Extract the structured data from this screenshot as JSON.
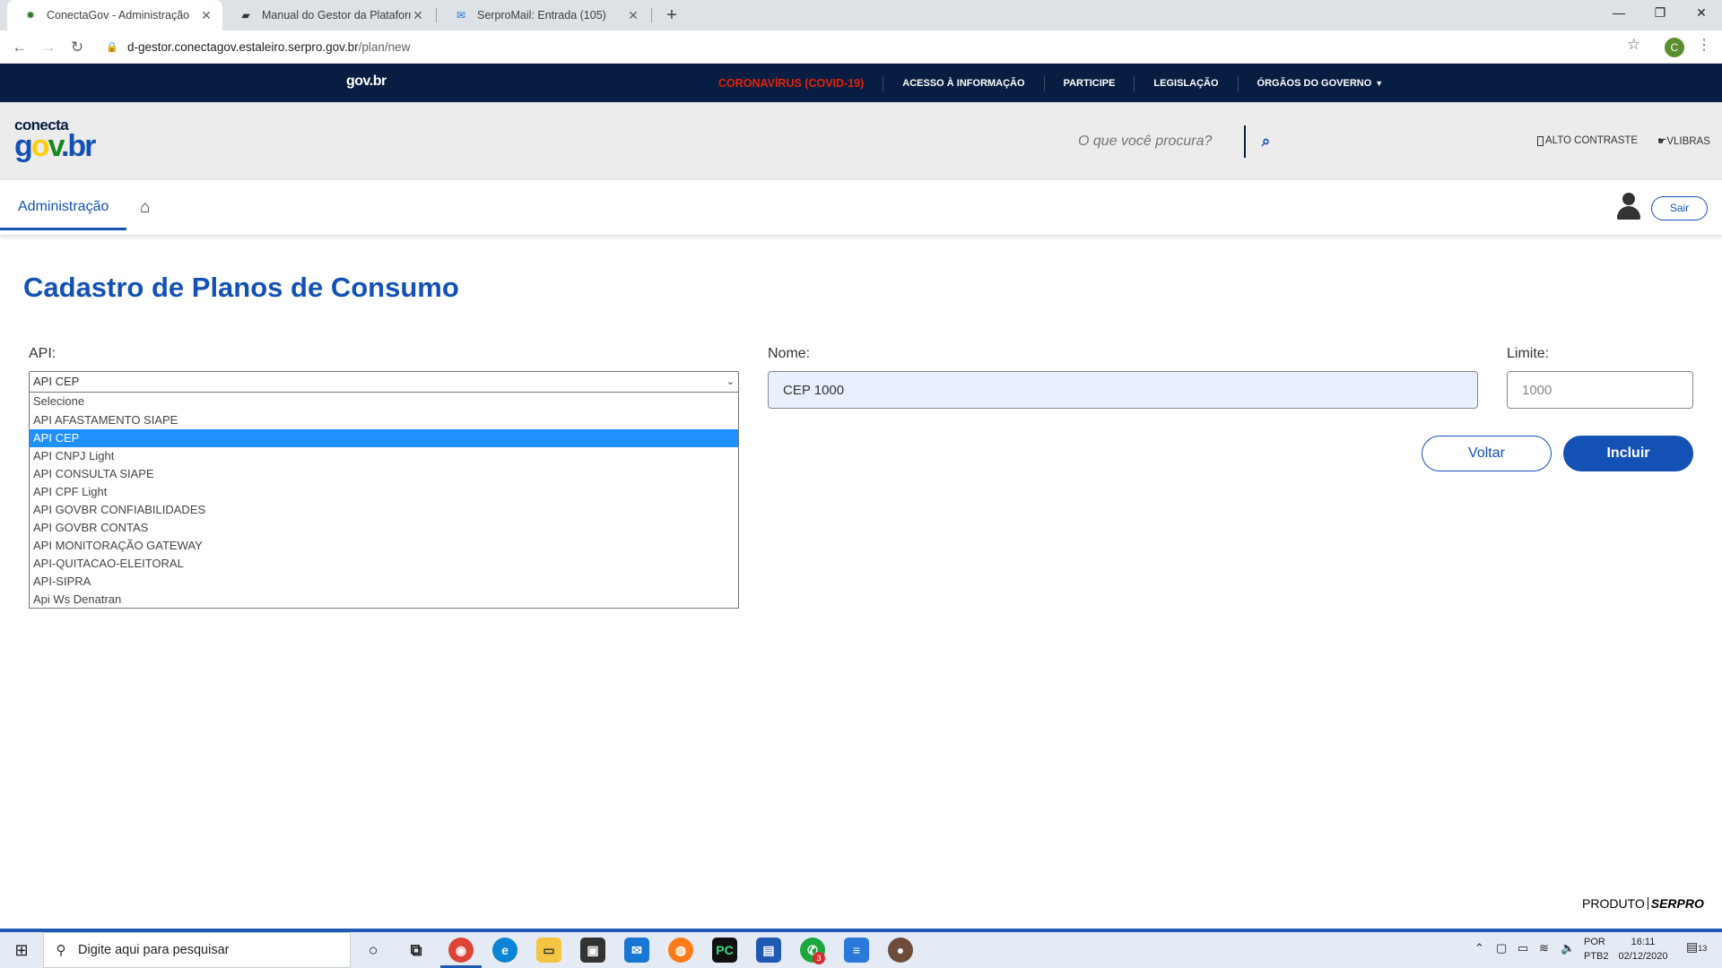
{
  "browser": {
    "tabs": [
      {
        "title": "ConectaGov - Administração",
        "favicon": "gov-gear-icon",
        "active": true
      },
      {
        "title": "Manual do Gestor da Plataforma",
        "favicon": "book-icon",
        "active": false
      },
      {
        "title": "SerproMail: Entrada (105)",
        "favicon": "mail-icon",
        "active": false
      }
    ],
    "url_host": "d-gestor.conectagov.estaleiro.serpro.gov.br",
    "url_path": "/plan/new",
    "profile_initial": "C"
  },
  "govbar": {
    "brand": "gov.br",
    "links": {
      "covid": "CORONAVÍRUS (COVID-19)",
      "acesso": "ACESSO À INFORMAÇÃO",
      "participe": "PARTICIPE",
      "legislacao": "LEGISLAÇÃO",
      "orgaos": "ÓRGÃOS DO GOVERNO"
    },
    "covid_color": "#e52207"
  },
  "header": {
    "logo_top": "conecta",
    "logo_g": "g",
    "logo_o": "o",
    "logo_v": "v",
    "logo_br": ".br",
    "search_placeholder": "O que você procura?",
    "contrast_label": "ALTO CONTRASTE",
    "vlibras_label": "VLIBRAS"
  },
  "appnav": {
    "admin_label": "Administração",
    "logout_label": "Sair"
  },
  "page": {
    "title": "Cadastro de Planos de Consumo",
    "accent_color": "#1351b4"
  },
  "form": {
    "api_label": "API:",
    "api_value": "API CEP",
    "api_options": [
      "Selecione",
      "API AFASTAMENTO SIAPE",
      "API CEP",
      "API CNPJ Light",
      "API CONSULTA SIAPE",
      "API CPF Light",
      "API GOVBR CONFIABILIDADES",
      "API GOVBR CONTAS",
      "API MONITORAÇÃO GATEWAY",
      "API-QUITACAO-ELEITORAL",
      "API-SIPRA",
      "Api Ws Denatran"
    ],
    "api_selected_index": 2,
    "nome_label": "Nome:",
    "nome_value": "CEP 1000",
    "limite_label": "Limite:",
    "limite_value": "1000",
    "voltar_label": "Voltar",
    "incluir_label": "Incluir"
  },
  "footer": {
    "produto": "PRODUTO",
    "serpro": "SERPRO"
  },
  "taskbar": {
    "search_placeholder": "Digite aqui para pesquisar",
    "notification_count": "3",
    "lang_top": "POR",
    "lang_bottom": "PTB2",
    "time": "16:11",
    "date": "02/12/2020",
    "action_center_count": "13"
  }
}
